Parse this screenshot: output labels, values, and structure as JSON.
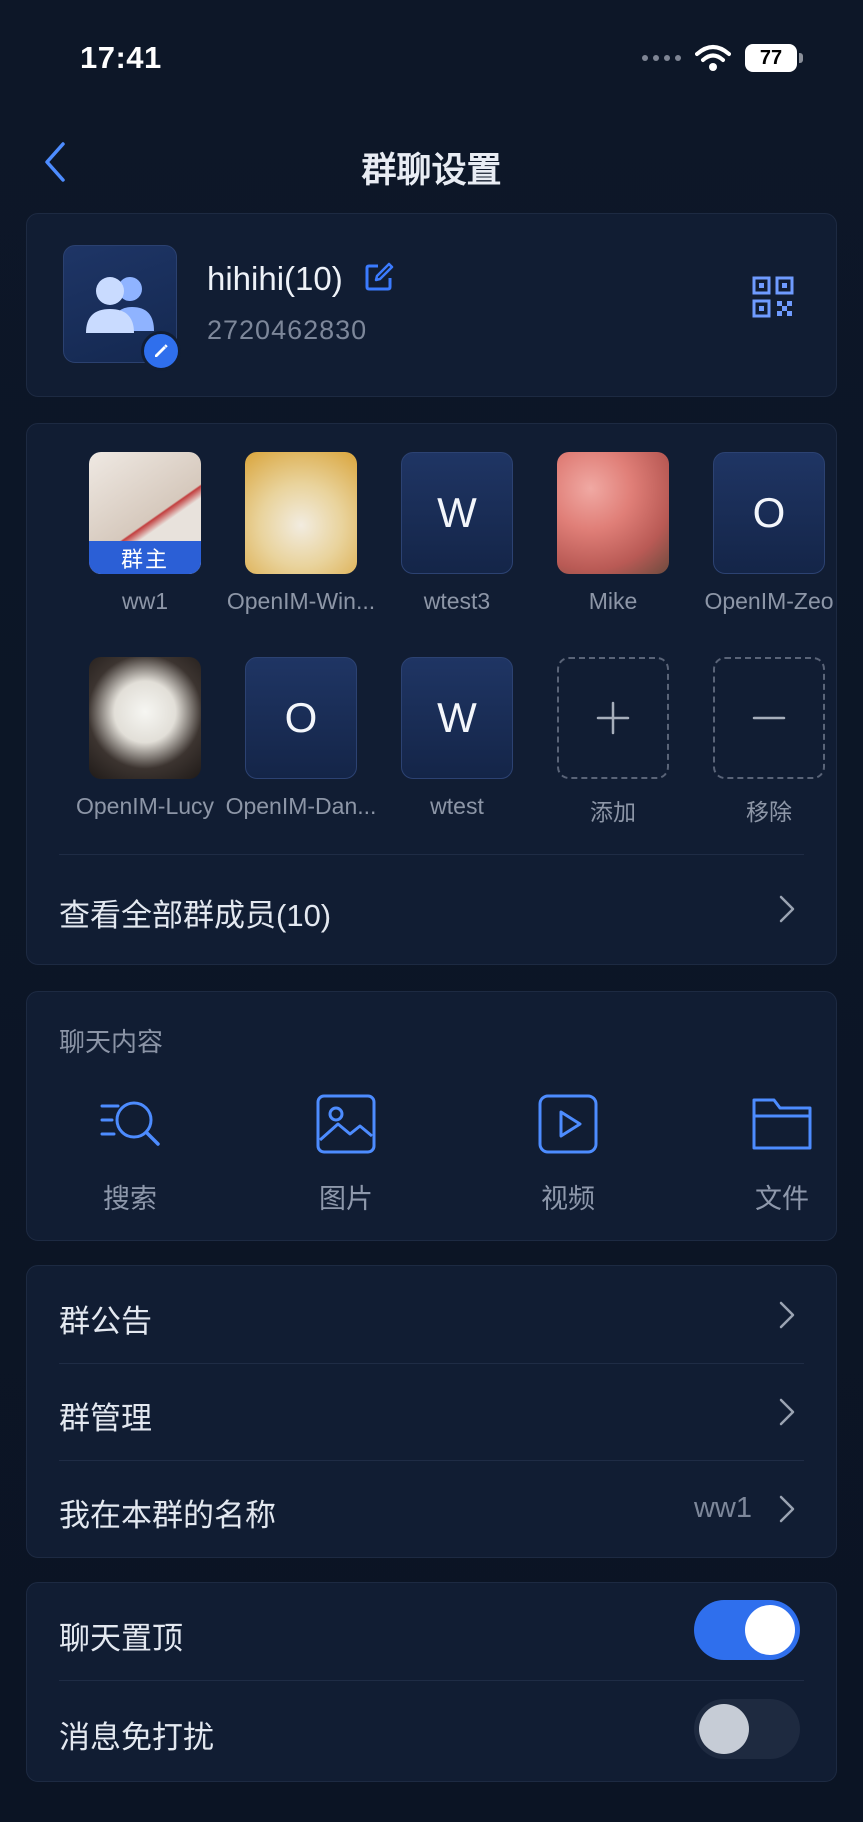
{
  "status_bar": {
    "time": "17:41",
    "battery": "77"
  },
  "nav": {
    "title": "群聊设置"
  },
  "group": {
    "name": "hihihi(10)",
    "id": "2720462830"
  },
  "members": [
    {
      "name": "ww1",
      "avatar": "photo",
      "badge": "群主"
    },
    {
      "name": "OpenIM-Win...",
      "avatar": "photo"
    },
    {
      "name": "wtest3",
      "avatar": "letter",
      "letter": "W"
    },
    {
      "name": "Mike",
      "avatar": "photo"
    },
    {
      "name": "OpenIM-Zeo",
      "avatar": "letter",
      "letter": "O"
    },
    {
      "name": "OpenIM-Lucy",
      "avatar": "photo"
    },
    {
      "name": "OpenIM-Dan...",
      "avatar": "letter",
      "letter": "O"
    },
    {
      "name": "wtest",
      "avatar": "letter",
      "letter": "W"
    }
  ],
  "member_actions": {
    "add": "添加",
    "remove": "移除"
  },
  "view_all_members": "查看全部群成员(10)",
  "chat_content": {
    "title": "聊天内容",
    "items": [
      {
        "label": "搜索",
        "icon": "search-list-icon"
      },
      {
        "label": "图片",
        "icon": "image-icon"
      },
      {
        "label": "视频",
        "icon": "video-icon"
      },
      {
        "label": "文件",
        "icon": "folder-icon"
      }
    ]
  },
  "settings": {
    "announcement": "群公告",
    "management": "群管理",
    "my_nickname_label": "我在本群的名称",
    "my_nickname_value": "ww1"
  },
  "toggles": {
    "pin_chat": {
      "label": "聊天置顶",
      "on": true
    },
    "mute": {
      "label": "消息免打扰",
      "on": false
    }
  },
  "colors": {
    "accent": "#2f6fed",
    "background": "#0c1526",
    "card": "#111d33"
  }
}
